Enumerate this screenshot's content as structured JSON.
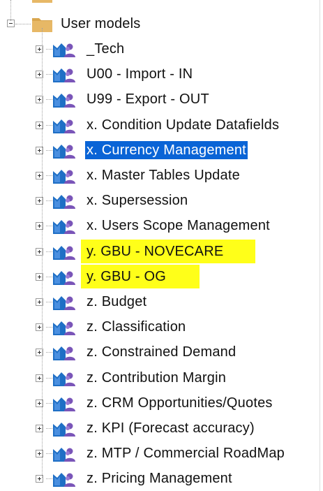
{
  "tree": {
    "root": {
      "label": "User models",
      "expander_icon": "minus-box-icon",
      "icon": "folder-icon",
      "folder_color": "#e7b866"
    },
    "items": [
      {
        "label": "_Tech",
        "state": "normal"
      },
      {
        "label": "U00 - Import - IN",
        "state": "normal"
      },
      {
        "label": "U99 - Export - OUT",
        "state": "normal"
      },
      {
        "label": "x. Condition Update Datafields",
        "state": "normal"
      },
      {
        "label": "x. Currency Management",
        "state": "selected"
      },
      {
        "label": "x. Master Tables Update",
        "state": "normal"
      },
      {
        "label": "x. Supersession",
        "state": "normal"
      },
      {
        "label": "x. Users Scope Management",
        "state": "normal"
      },
      {
        "label": "y. GBU - NOVECARE",
        "state": "highlighted"
      },
      {
        "label": "y. GBU - OG",
        "state": "highlighted"
      },
      {
        "label": "z. Budget",
        "state": "normal"
      },
      {
        "label": "z. Classification",
        "state": "normal"
      },
      {
        "label": "z. Constrained Demand",
        "state": "normal"
      },
      {
        "label": "z. Contribution Margin",
        "state": "normal"
      },
      {
        "label": "z. CRM Opportunities/Quotes",
        "state": "normal"
      },
      {
        "label": "z. KPI (Forecast accuracy)",
        "state": "normal"
      },
      {
        "label": "z. MTP / Commercial RoadMap",
        "state": "normal"
      },
      {
        "label": "z. Pricing Management",
        "state": "normal"
      }
    ],
    "item_icon": "user-model-icon",
    "item_expander_icon": "plus-box-icon",
    "colors": {
      "selection": "#0a64d6",
      "highlight": "#ffff19",
      "icon_blue": "#1f6fc5",
      "icon_purple": "#7a55b8"
    }
  }
}
